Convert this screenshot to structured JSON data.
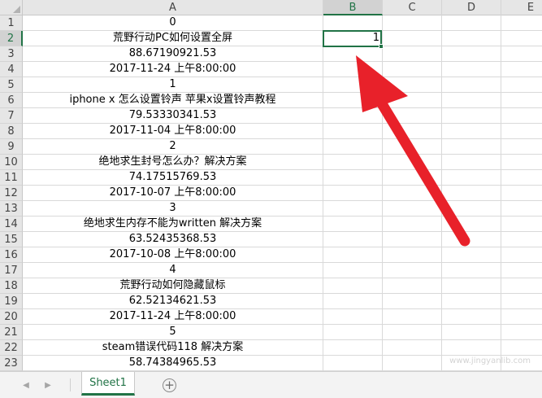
{
  "columns": [
    "A",
    "B",
    "C",
    "D",
    "E"
  ],
  "selected_column": "B",
  "selected_row": 2,
  "rows": [
    {
      "num": "1",
      "a": "0"
    },
    {
      "num": "2",
      "a": "荒野行动PC如何设置全屏",
      "b": "1"
    },
    {
      "num": "3",
      "a": "88.67190921.53"
    },
    {
      "num": "4",
      "a": "2017-11-24 上午8:00:00"
    },
    {
      "num": "5",
      "a": "1"
    },
    {
      "num": "6",
      "a": "iphone x 怎么设置铃声 苹果x设置铃声教程"
    },
    {
      "num": "7",
      "a": "79.53330341.53"
    },
    {
      "num": "8",
      "a": "2017-11-04 上午8:00:00"
    },
    {
      "num": "9",
      "a": "2"
    },
    {
      "num": "10",
      "a": "绝地求生封号怎么办？解决方案"
    },
    {
      "num": "11",
      "a": "74.17515769.53"
    },
    {
      "num": "12",
      "a": "2017-10-07 上午8:00:00"
    },
    {
      "num": "13",
      "a": "3"
    },
    {
      "num": "14",
      "a": "绝地求生内存不能为written 解决方案"
    },
    {
      "num": "15",
      "a": "63.52435368.53"
    },
    {
      "num": "16",
      "a": "2017-10-08 上午8:00:00"
    },
    {
      "num": "17",
      "a": "4"
    },
    {
      "num": "18",
      "a": "荒野行动如何隐藏鼠标"
    },
    {
      "num": "19",
      "a": "62.52134621.53"
    },
    {
      "num": "20",
      "a": "2017-11-24 上午8:00:00"
    },
    {
      "num": "21",
      "a": "5"
    },
    {
      "num": "22",
      "a": "steam错误代码118 解决方案"
    },
    {
      "num": "23",
      "a": "58.74384965.53"
    }
  ],
  "sheet_tabs": [
    "Sheet1"
  ],
  "add_sheet_label": "+",
  "nav_prev_label": "◀",
  "nav_next_label": "▶",
  "watermark": "www.jingyanlib.com",
  "colors": {
    "accent": "#217346",
    "arrow": "#e8212a",
    "header_bg": "#e6e6e6"
  }
}
